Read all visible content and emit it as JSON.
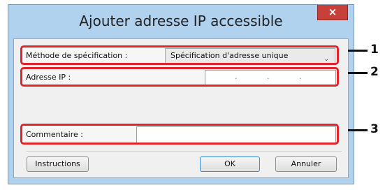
{
  "dialog": {
    "title": "Ajouter adresse IP accessible",
    "close_symbol": "×"
  },
  "specification": {
    "label": "Méthode de spécification :",
    "selected": "Spécification d'adresse unique"
  },
  "ip": {
    "label": "Adresse IP :",
    "dots": [
      ".",
      ".",
      "."
    ]
  },
  "comment": {
    "label": "Commentaire :",
    "value": ""
  },
  "buttons": {
    "instructions": "Instructions",
    "ok": "OK",
    "cancel": "Annuler"
  },
  "callouts": [
    "1",
    "2",
    "3"
  ],
  "colors": {
    "highlight": "#e0262a",
    "close_button": "#c7403a",
    "frame": "#b0d2ee"
  },
  "icons": {
    "close": "close-icon",
    "dropdown": "chevron-down-icon"
  }
}
